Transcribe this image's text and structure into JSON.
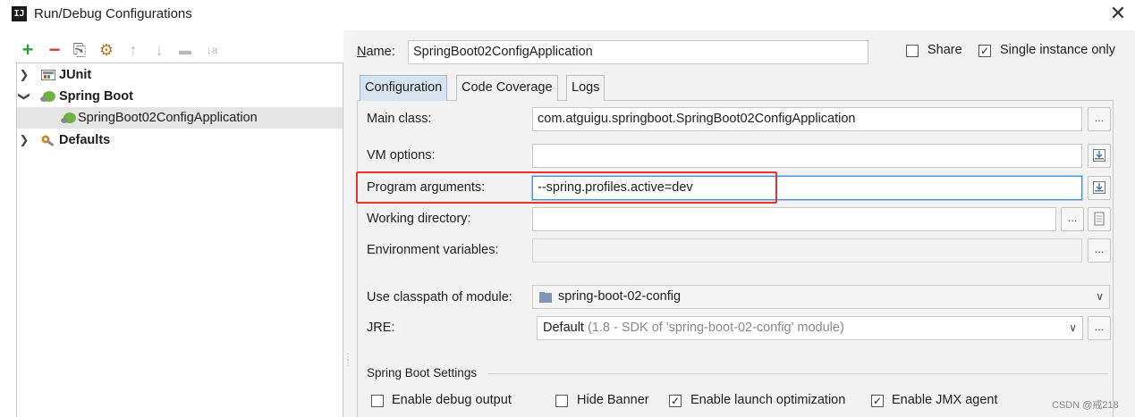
{
  "window": {
    "title": "Run/Debug Configurations",
    "app_icon_text": "IJ",
    "close": "✕"
  },
  "toolbar": {
    "add": "+",
    "remove": "−",
    "copy": "⎘",
    "edit": "⚙",
    "up": "↑",
    "down": "↓",
    "folder": "▬",
    "sort": "↓a"
  },
  "tree": {
    "items": [
      {
        "label": "JUnit",
        "bold": true,
        "expanded": false
      },
      {
        "label": "Spring Boot",
        "bold": true,
        "expanded": true
      },
      {
        "label": "SpringBoot02ConfigApplication",
        "bold": false,
        "selected": true
      },
      {
        "label": "Defaults",
        "bold": true,
        "expanded": false
      }
    ]
  },
  "header": {
    "name_label": "Name:",
    "name_value": "SpringBoot02ConfigApplication",
    "share_label": "Share",
    "share_checked": false,
    "single_instance_label": "Single instance only",
    "single_instance_checked": true
  },
  "tabs": [
    {
      "label": "Configuration",
      "active": true
    },
    {
      "label": "Code Coverage",
      "active": false
    },
    {
      "label": "Logs",
      "active": false
    }
  ],
  "form": {
    "main_class_label": "Main class:",
    "main_class_value": "com.atguigu.springboot.SpringBoot02ConfigApplication",
    "vm_options_label": "VM options:",
    "vm_options_value": "",
    "program_args_label": "Program arguments:",
    "program_args_value": "--spring.profiles.active=dev",
    "working_dir_label": "Working directory:",
    "working_dir_value": "",
    "env_vars_label": "Environment variables:",
    "env_vars_value": "",
    "module_label": "Use classpath of module:",
    "module_value": "spring-boot-02-config",
    "jre_label": "JRE:",
    "jre_value": "Default",
    "jre_detail": "(1.8 - SDK of 'spring-boot-02-config' module)",
    "browse": "..."
  },
  "spring_boot_settings": {
    "title": "Spring Boot Settings",
    "options": [
      {
        "label": "Enable debug output",
        "checked": false
      },
      {
        "label": "Hide Banner",
        "checked": false
      },
      {
        "label": "Enable launch optimization",
        "checked": true
      },
      {
        "label": "Enable JMX agent",
        "checked": true
      }
    ]
  },
  "watermark": "CSDN @戒218",
  "colors": {
    "highlight": "#e8322b",
    "tab_active": "#d7e3ef",
    "add_green": "#2e9e44",
    "remove_red": "#d23b3b"
  }
}
